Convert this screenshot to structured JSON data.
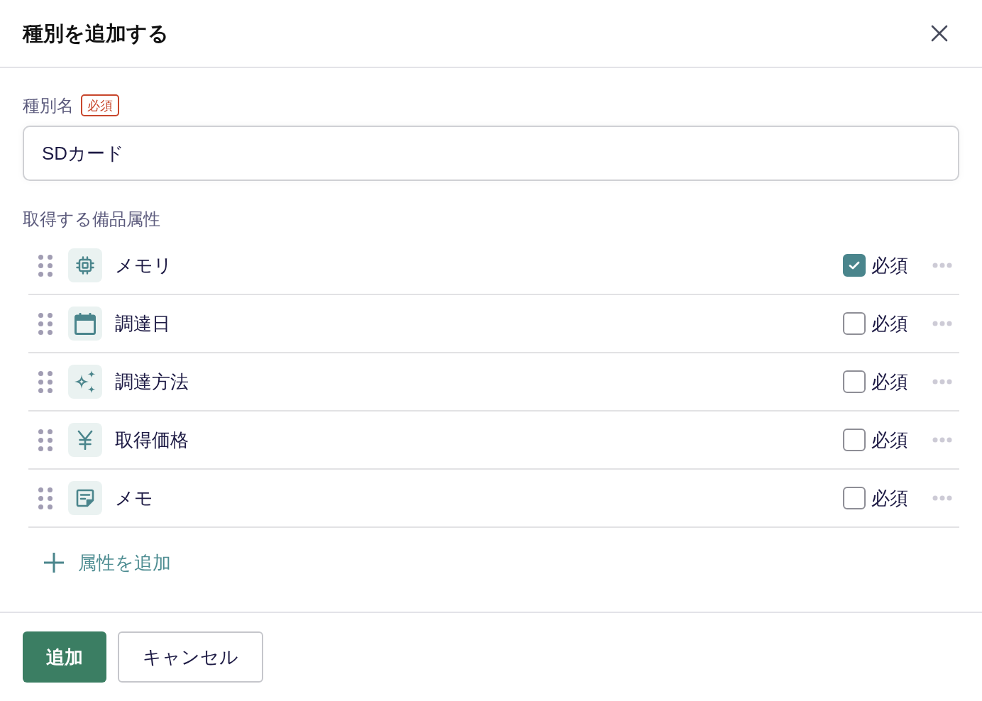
{
  "dialog": {
    "title": "種別を追加する"
  },
  "name_field": {
    "label": "種別名",
    "required_tag": "必須",
    "value": "SDカード"
  },
  "attributes_section": {
    "label": "取得する備品属性",
    "items": [
      {
        "kind": "chip",
        "name": "メモリ",
        "required_label": "必須",
        "required": true
      },
      {
        "kind": "calendar",
        "name": "調達日",
        "required_label": "必須",
        "required": false
      },
      {
        "kind": "sparkle",
        "name": "調達方法",
        "required_label": "必須",
        "required": false
      },
      {
        "kind": "yen",
        "name": "取得価格",
        "required_label": "必須",
        "required": false
      },
      {
        "kind": "note",
        "name": "メモ",
        "required_label": "必須",
        "required": false
      }
    ]
  },
  "add_attribute": {
    "label": "属性を追加"
  },
  "buttons": [
    {
      "kind": "primary",
      "label": "追加"
    },
    {
      "kind": "secondary",
      "label": "キャンセル"
    }
  ]
}
